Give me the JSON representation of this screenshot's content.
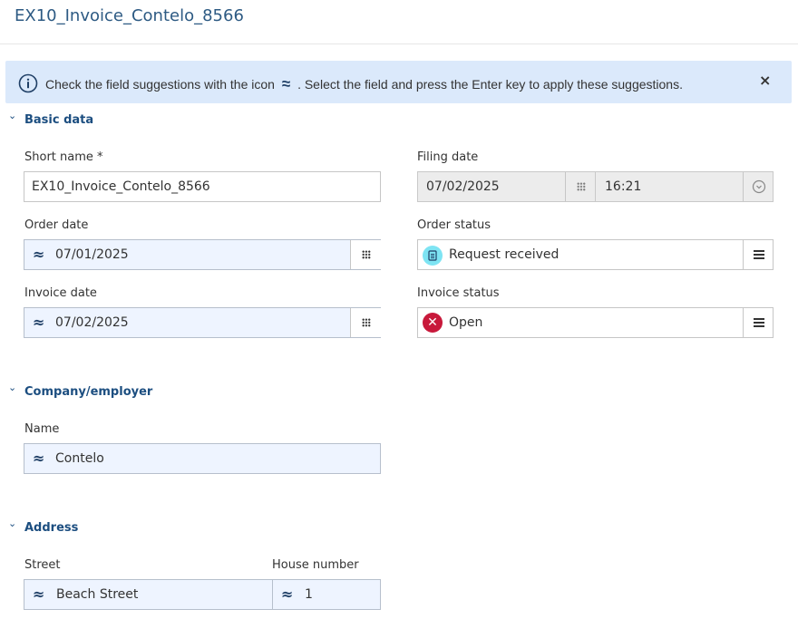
{
  "header": {
    "title": "EX10_Invoice_Contelo_8566"
  },
  "banner": {
    "text_before": "Check the field suggestions with the icon",
    "icon_glyph": "≈",
    "text_after": ". Select the field and press the Enter key to apply these suggestions.",
    "close": "×",
    "icon": "info-icon"
  },
  "sections": {
    "basic": "Basic data",
    "company": "Company/employer",
    "address": "Address"
  },
  "chevron": "⌄",
  "suggest_glyph": "≈",
  "fields": {
    "short_name": {
      "label": "Short name *",
      "value": "EX10_Invoice_Contelo_8566"
    },
    "filing_date": {
      "label": "Filing date",
      "date": "07/02/2025",
      "time": "16:21"
    },
    "order_date": {
      "label": "Order date",
      "value": "07/01/2025"
    },
    "order_status": {
      "label": "Order status",
      "value": "Request received"
    },
    "invoice_date": {
      "label": "Invoice date",
      "value": "07/02/2025"
    },
    "invoice_status": {
      "label": "Invoice status",
      "value": "Open",
      "icon_glyph": "✕"
    },
    "name": {
      "label": "Name",
      "value": "Contelo"
    },
    "street": {
      "label": "Street",
      "value": "Beach Street"
    },
    "house_number": {
      "label": "House number",
      "value": "1"
    }
  },
  "colors": {
    "accent": "#1c4e80",
    "banner": "#dbe9fb",
    "suggest_bg": "#eef4ff",
    "status_open": "#c8193b",
    "status_request": "#7ee4f3"
  }
}
